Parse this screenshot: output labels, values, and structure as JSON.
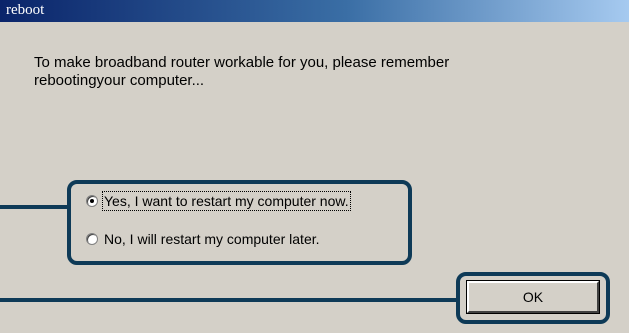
{
  "window": {
    "title": "reboot"
  },
  "message": {
    "line1": "To make broadband router workable for you, please remember",
    "line2": "rebootingyour computer..."
  },
  "options": [
    {
      "label": "Yes, I want to restart my computer now.",
      "selected": true
    },
    {
      "label": "No, I will restart my computer later.",
      "selected": false
    }
  ],
  "buttons": {
    "ok_label": "OK"
  },
  "colors": {
    "callout": "#0e3a57",
    "dialog_bg": "#d4d0c8",
    "titlebar_start": "#0a246a",
    "titlebar_end": "#a6caf0"
  }
}
